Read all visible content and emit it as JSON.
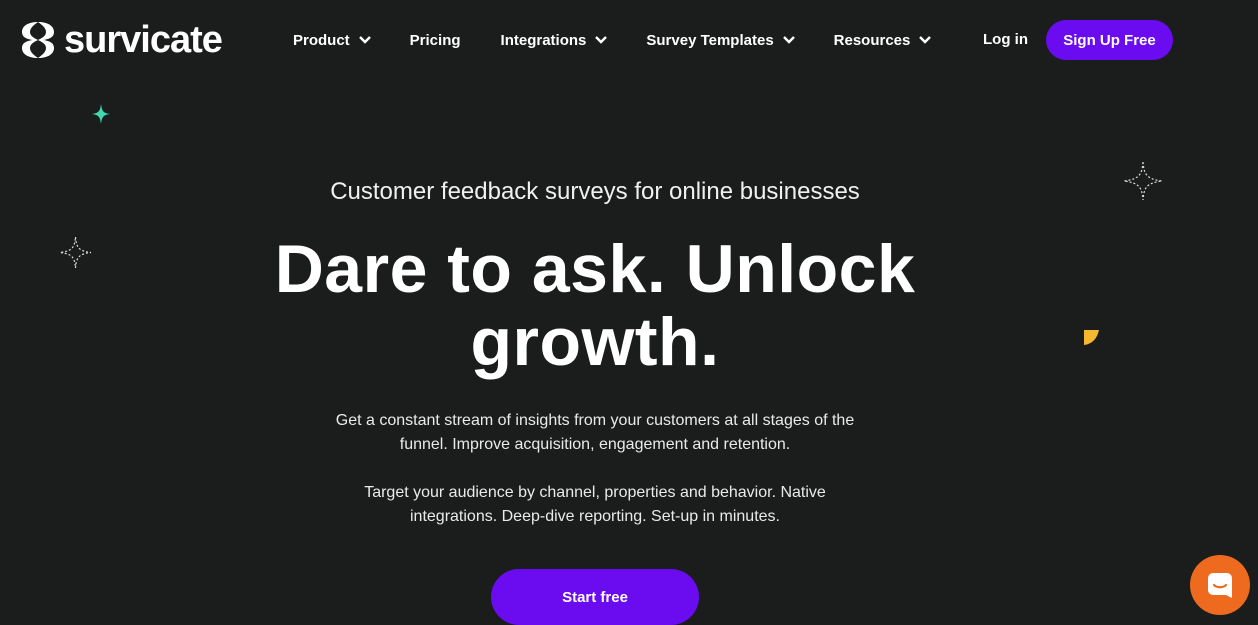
{
  "brand": {
    "name": "survicate",
    "accent": "#6a0bf0",
    "background": "#1a1d1c"
  },
  "nav": {
    "items": [
      {
        "label": "Product",
        "has_dropdown": true
      },
      {
        "label": "Pricing",
        "has_dropdown": false
      },
      {
        "label": "Integrations",
        "has_dropdown": true
      },
      {
        "label": "Survey Templates",
        "has_dropdown": true
      },
      {
        "label": "Resources",
        "has_dropdown": true
      }
    ],
    "login_label": "Log in",
    "signup_label": "Sign Up Free"
  },
  "hero": {
    "eyebrow": "Customer feedback surveys for online businesses",
    "headline": "Dare to ask. Unlock growth.",
    "paragraph1": "Get a constant stream of insights from your customers at all stages of the funnel. Improve acquisition, engagement and retention.",
    "paragraph2": "Target your audience by channel, properties and behavior. Native integrations. Deep-dive reporting. Set-up in minutes.",
    "cta_label": "Start free"
  },
  "icons": {
    "logo": "survicate-logo-icon",
    "dropdown": "chevron-down-icon",
    "chat": "chat-icon",
    "sparkle_colors": {
      "teal": "#3fd6b0",
      "yellow": "#f5b82e"
    }
  }
}
